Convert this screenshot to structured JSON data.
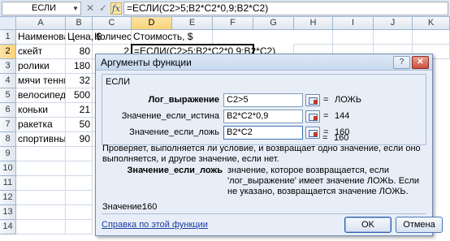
{
  "formula_bar": {
    "name_box": "ЕСЛИ",
    "cancel_symbol": "✕",
    "enter_symbol": "✓",
    "fx_label": "fx",
    "formula": "=ЕСЛИ(C2>5;B2*C2*0,9;B2*C2)"
  },
  "columns": [
    "A",
    "B",
    "C",
    "D",
    "E",
    "F",
    "G",
    "H",
    "I",
    "J",
    "K"
  ],
  "rows": [
    "1",
    "2",
    "3",
    "4",
    "5",
    "6",
    "7",
    "8",
    "9",
    "10",
    "11",
    "12",
    "13",
    "14"
  ],
  "cells": {
    "a1": "Наименование",
    "b1": "Цена, $",
    "c1": "Количество",
    "d1": "Стоимость, $",
    "d2_edit": "=ЕСЛИ(C2>5;B2*C2*0,9;B2*C2)",
    "col_a": [
      "скейт",
      "ролики",
      "мячи теннисные",
      "велосипед",
      "коньки",
      "ракетка",
      "спортивный костюм"
    ],
    "col_b": [
      "80",
      "180",
      "32",
      "500",
      "21",
      "50",
      "90"
    ],
    "col_c": [
      "2",
      "",
      "",
      "",
      "",
      "",
      ""
    ]
  },
  "dialog": {
    "title": "Аргументы функции",
    "minimize_symbol": "?",
    "close_symbol": "✕",
    "group_title": "ЕСЛИ",
    "args": [
      {
        "label": "Лог_выражение",
        "value": "C2>5",
        "eq": "=",
        "result": "ЛОЖЬ"
      },
      {
        "label": "Значение_если_истина",
        "value": "B2*C2*0,9",
        "eq": "=",
        "result": "144"
      },
      {
        "label": "Значение_если_ложь",
        "value": "B2*C2",
        "eq": "=",
        "result": "160"
      }
    ],
    "overall_eq": "=",
    "overall_result": "160",
    "description": "Проверяет, выполняется ли условие, и возвращает одно значение, если оно выполняется, и другое значение, если нет.",
    "arg_name": "Значение_если_ложь",
    "arg_description": "значение, которое возвращается, если 'лог_выражение' имеет значение ЛОЖЬ. Если не указано, возвращается значение ЛОЖЬ.",
    "value_label": "Значение:",
    "value_result": "160",
    "help_link": "Справка по этой функции",
    "ok_label": "OK",
    "cancel_label": "Отмена"
  }
}
